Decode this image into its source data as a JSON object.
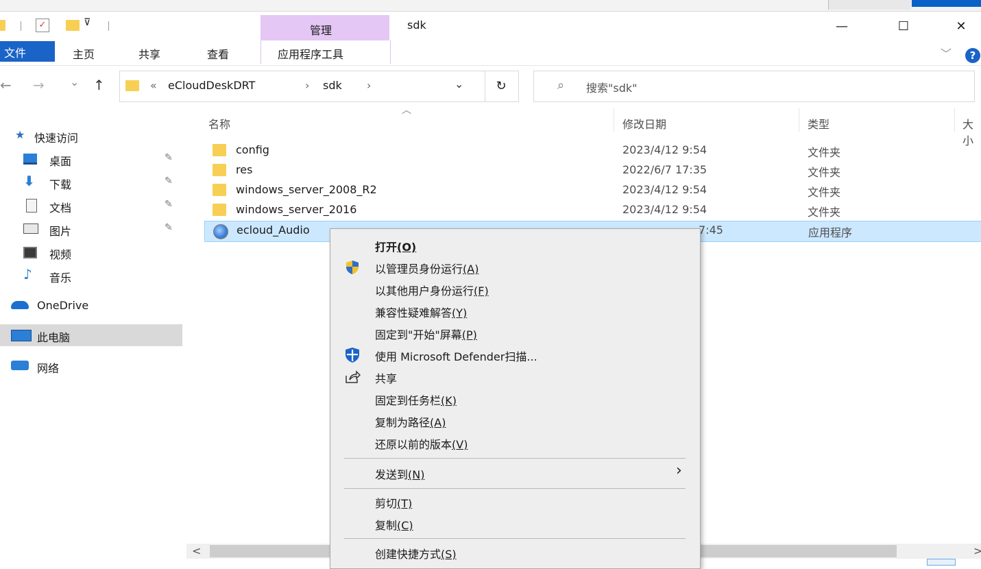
{
  "window": {
    "title": "sdk",
    "context_tab_group": "管理",
    "controls": {
      "minimize": "—",
      "maximize": "☐",
      "close": "✕"
    }
  },
  "ribbon": {
    "tabs": [
      "文件",
      "主页",
      "共享",
      "查看",
      "应用程序工具"
    ],
    "collapse": "﹀",
    "help": "?"
  },
  "address": {
    "nav_back": "←",
    "nav_forward": "→",
    "nav_recent": "⌄",
    "nav_up": "↑",
    "overflow": "«",
    "crumbs": [
      "eCloudDeskDRT",
      "sdk"
    ],
    "crumb_sep": "›",
    "dropdown": "⌄",
    "refresh": "↻",
    "search_icon": "⌕",
    "search_placeholder": "搜索\"sdk\""
  },
  "nav_pane": {
    "quick_access": "快速访问",
    "items": [
      {
        "label": "桌面",
        "pinned": true
      },
      {
        "label": "下载",
        "pinned": true
      },
      {
        "label": "文档",
        "pinned": true
      },
      {
        "label": "图片",
        "pinned": true
      },
      {
        "label": "视频",
        "pinned": false
      },
      {
        "label": "音乐",
        "pinned": false
      }
    ],
    "onedrive": "OneDrive",
    "this_pc": "此电脑",
    "network": "网络",
    "pin_glyph": "📌"
  },
  "columns": {
    "name": "名称",
    "date": "修改日期",
    "type": "类型",
    "size": "大小",
    "sort_arrow": "︿"
  },
  "files": [
    {
      "name": "config",
      "date": "2023/4/12 9:54",
      "type": "文件夹"
    },
    {
      "name": "res",
      "date": "2022/6/7 17:35",
      "type": "文件夹"
    },
    {
      "name": "windows_server_2008_R2",
      "date": "2023/4/12 9:54",
      "type": "文件夹"
    },
    {
      "name": "windows_server_2016",
      "date": "2023/4/12 9:54",
      "type": "文件夹"
    },
    {
      "name": "ecloud_Audio",
      "date": "7:45",
      "type": "应用程序",
      "selected": true
    }
  ],
  "scrollbar": {
    "left": "<",
    "right": ">"
  },
  "context_menu": {
    "items": [
      {
        "label": "打开",
        "key": "(O)",
        "bold": true
      },
      {
        "label": "以管理员身份运行",
        "key": "(A)",
        "icon": "uac-shield"
      },
      {
        "label": "以其他用户身份运行",
        "key": "(F)"
      },
      {
        "label": "兼容性疑难解答",
        "key": "(Y)"
      },
      {
        "label": "固定到\"开始\"屏幕",
        "key": "(P)"
      },
      {
        "label": "使用 Microsoft Defender扫描...",
        "key": "",
        "icon": "defender-shield"
      },
      {
        "label": "共享",
        "key": "",
        "icon": "share"
      },
      {
        "label": "固定到任务栏",
        "key": "(K)"
      },
      {
        "label": "复制为路径",
        "key": "(A)"
      },
      {
        "label": "还原以前的版本",
        "key": "(V)"
      },
      {
        "label": "发送到",
        "key": "(N)",
        "submenu": true
      },
      {
        "label": "剪切",
        "key": "(T)"
      },
      {
        "label": "复制",
        "key": "(C)"
      },
      {
        "label": "创建快捷方式",
        "key": "(S)"
      }
    ],
    "submenu_arrow": "›"
  }
}
